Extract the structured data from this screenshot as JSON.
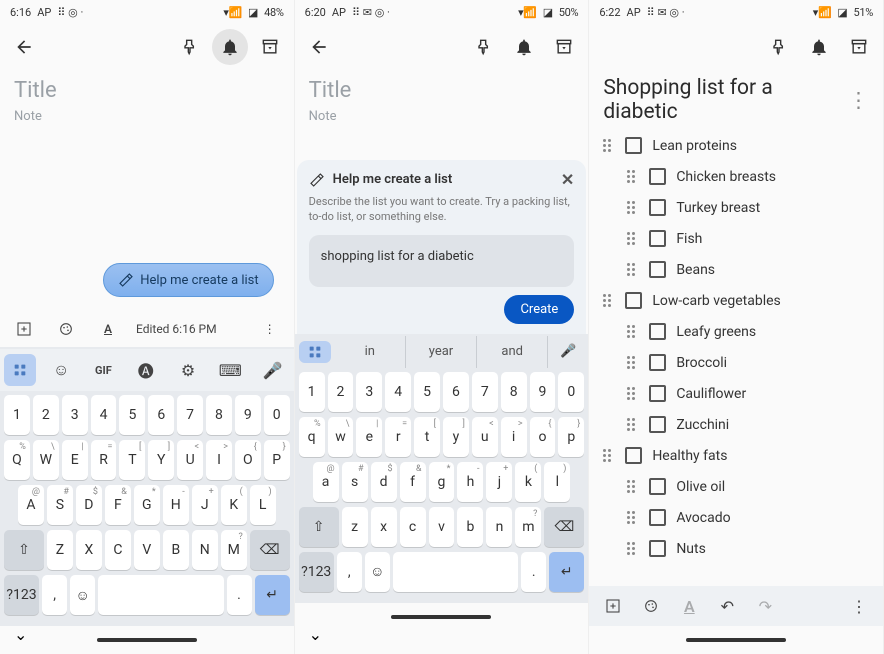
{
  "screens": [
    {
      "status": {
        "time": "6:16",
        "ap": "AP",
        "battery": "48%"
      },
      "title_placeholder": "Title",
      "note_placeholder": "Note",
      "help_chip": "Help me create a list",
      "edited": "Edited 6:16 PM",
      "keyboard": {
        "rows": [
          [
            "1",
            "2",
            "3",
            "4",
            "5",
            "6",
            "7",
            "8",
            "9",
            "0"
          ],
          [
            "Q",
            "W",
            "E",
            "R",
            "T",
            "Y",
            "U",
            "I",
            "O",
            "P"
          ],
          [
            "A",
            "S",
            "D",
            "F",
            "G",
            "H",
            "J",
            "K",
            "L"
          ],
          [
            "Z",
            "X",
            "C",
            "V",
            "B",
            "N",
            "M"
          ]
        ],
        "sups_row2": [
          "%",
          "\\",
          "|",
          "=",
          "[",
          "]",
          "<",
          ">",
          "{",
          "}"
        ],
        "sups_row3": [
          "@",
          "#",
          "$",
          "&",
          "*",
          "-",
          "+",
          "(",
          ")"
        ],
        "sups_row4": [
          "",
          "",
          "",
          "",
          "",
          "",
          "?"
        ],
        "modeKey": "?123",
        "comma": ",",
        "period": ".",
        "gifLabel": "GIF"
      }
    },
    {
      "status": {
        "time": "6:20",
        "ap": "AP",
        "battery": "50%"
      },
      "title_placeholder": "Title",
      "note_placeholder": "Note",
      "panel": {
        "title": "Help me create a list",
        "desc": "Describe the list you want to create. Try a packing list, to-do list, or something else.",
        "input": "shopping list for a diabetic",
        "cta": "Create"
      },
      "suggestions": [
        "in",
        "year",
        "and"
      ],
      "keyboard": {
        "rows": [
          [
            "1",
            "2",
            "3",
            "4",
            "5",
            "6",
            "7",
            "8",
            "9",
            "0"
          ],
          [
            "q",
            "w",
            "e",
            "r",
            "t",
            "y",
            "u",
            "i",
            "o",
            "p"
          ],
          [
            "a",
            "s",
            "d",
            "f",
            "g",
            "h",
            "j",
            "k",
            "l"
          ],
          [
            "z",
            "x",
            "c",
            "v",
            "b",
            "n",
            "m"
          ]
        ],
        "sups_row2": [
          "%",
          "\\",
          "|",
          "=",
          "[",
          "]",
          "<",
          ">",
          "{",
          "}"
        ],
        "sups_row3": [
          "@",
          "#",
          "$",
          "&",
          "*",
          "-",
          "+",
          "(",
          ")"
        ],
        "sups_row4": [
          "",
          "",
          "",
          "",
          "",
          "",
          "?"
        ],
        "modeKey": "?123",
        "comma": ",",
        "period": "."
      }
    },
    {
      "status": {
        "time": "6:22",
        "ap": "AP",
        "battery": "51%"
      },
      "title": "Shopping list for a diabetic",
      "items": [
        {
          "text": "Lean proteins",
          "indent": 0
        },
        {
          "text": "Chicken breasts",
          "indent": 1
        },
        {
          "text": "Turkey breast",
          "indent": 1
        },
        {
          "text": "Fish",
          "indent": 1
        },
        {
          "text": "Beans",
          "indent": 1
        },
        {
          "text": "Low-carb vegetables",
          "indent": 0
        },
        {
          "text": "Leafy greens",
          "indent": 1
        },
        {
          "text": "Broccoli",
          "indent": 1
        },
        {
          "text": "Cauliflower",
          "indent": 1
        },
        {
          "text": "Zucchini",
          "indent": 1
        },
        {
          "text": "Healthy fats",
          "indent": 0
        },
        {
          "text": "Olive oil",
          "indent": 1
        },
        {
          "text": "Avocado",
          "indent": 1
        },
        {
          "text": "Nuts",
          "indent": 1
        }
      ]
    }
  ]
}
